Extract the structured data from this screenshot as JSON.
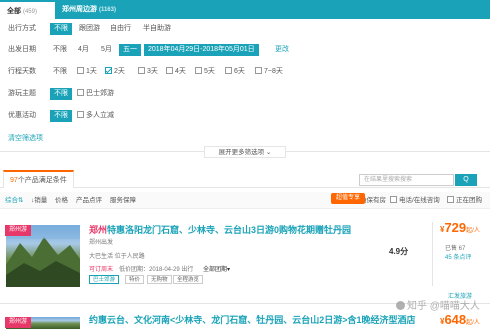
{
  "tabs": {
    "all_label": "全部",
    "all_count": "(459)",
    "zz_label": "郑州周边游",
    "zz_count": "(1163)"
  },
  "filters": {
    "travel_mode": {
      "label": "出行方式",
      "options": [
        "不限",
        "跟团游",
        "自由行",
        "半自助游"
      ]
    },
    "date": {
      "label": "出发日期",
      "options": [
        "不限",
        "4月",
        "5月",
        "五一"
      ],
      "range": "2018年04月29日-2018年05月01日",
      "change": "更改"
    },
    "days": {
      "label": "行程天数",
      "options": [
        "不限",
        "1天",
        "2天",
        "3天",
        "4天",
        "5天",
        "6天",
        "7~8天"
      ]
    },
    "theme": {
      "label": "游玩主题",
      "options": [
        "不限",
        "巴士郊游"
      ]
    },
    "promo": {
      "label": "优惠活动",
      "options": [
        "不限",
        "多人立减"
      ]
    },
    "clear": "清空筛选项",
    "expand": "展开更多筛选项"
  },
  "results": {
    "count": "97",
    "count_text": "个产品满足条件",
    "search_placeholder": "在结果里搜索搜索",
    "search_button": "Q"
  },
  "sort": {
    "items": [
      "综合",
      "销量",
      "价格",
      "产品点评",
      "服务保障"
    ],
    "hot": "超值专享",
    "checkboxes": [
      "确保有房",
      "电话/在线咨询",
      "正在团购"
    ]
  },
  "products": [
    {
      "ribbon": "郑州游",
      "city": "郑州",
      "title": "特惠洛阳龙门石窟、少林寺、云台山3日游0购物花期赠牡丹园",
      "depart": "郑州出发",
      "supplier": "大巴生活",
      "supplier_loc": "位于人民路",
      "promo": "可订周末",
      "date_text": "低价团期：2018-04-29 出行",
      "all_dates": "全部团期",
      "tags": [
        "巴士郊游",
        "特价",
        "无购物",
        "全程游览"
      ],
      "score": "4.9分",
      "sold": "已售 67",
      "reviews": "45 条点评",
      "price": "729",
      "price_symbol": "¥",
      "price_unit": "起/人",
      "link": "汇发旅游"
    },
    {
      "ribbon": "郑州游",
      "city": "",
      "title": "约惠云台、文化河南<少林寺、龙门石窟、牡丹园、云台山2日游>含1晚经济型酒店",
      "price": "648",
      "price_symbol": "¥",
      "price_unit": "起/人"
    }
  ],
  "watermark": "知乎 @喵喵大人",
  "colors": {
    "teal": "#1aa3b8",
    "orange": "#ff6600",
    "pink": "#e7386a"
  }
}
